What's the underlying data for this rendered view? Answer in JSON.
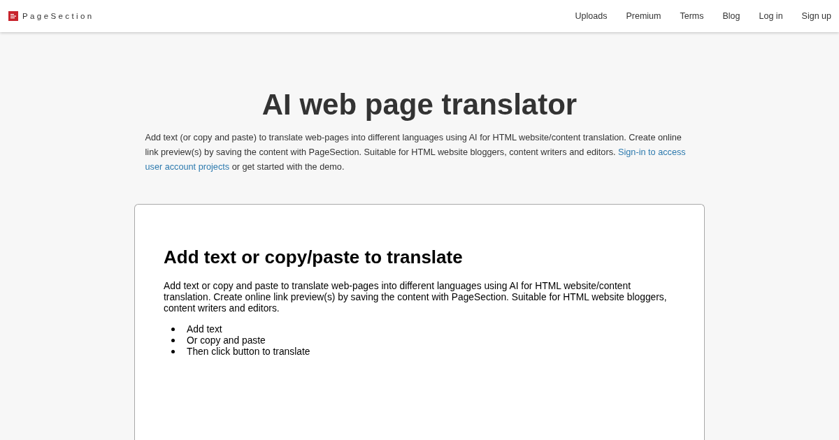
{
  "header": {
    "brand": "PageSection",
    "nav": [
      "Uploads",
      "Premium",
      "Terms",
      "Blog",
      "Log in",
      "Sign up"
    ]
  },
  "page": {
    "title": "AI web page translator",
    "intro": {
      "text_before": "Add text (or copy and paste) to translate web-pages into different languages using AI for HTML website/content translation. Create online link preview(s) by saving the content with PageSection. Suitable for HTML website bloggers, content writers and editors.",
      "link_parts": [
        "Sign-in to access",
        "user account projects"
      ],
      "text_after": "or get started with the demo."
    }
  },
  "editor": {
    "heading": "Add text or copy/paste to translate",
    "paragraph": "Add text or copy and paste to translate web-pages into different languages using AI for HTML website/content translation. Create online link preview(s) by saving the content with PageSection. Suitable for HTML website bloggers, content writers and editors.",
    "bullets": [
      "Add text",
      "Or copy and paste",
      "Then click button to translate"
    ]
  }
}
